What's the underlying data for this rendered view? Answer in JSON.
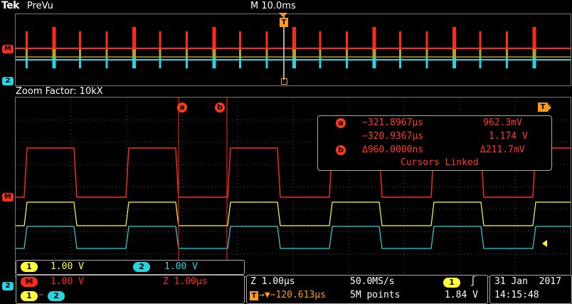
{
  "header": {
    "brand": "Tek",
    "mode": "PreVu",
    "timebase": "M 10.0ms"
  },
  "overview": {
    "trigger_marker": "T"
  },
  "zoom": {
    "label": "Zoom Factor: 10kX"
  },
  "markers": {
    "math_marker": "M",
    "ch2_marker": "2",
    "trigger_right": "T"
  },
  "cursors": {
    "a_label": "a",
    "b_label": "b",
    "readout": {
      "a_time": "−321.8967µs",
      "a_value": "962.3mV",
      "b_time": "−320.9367µs",
      "b_value": "1.174 V",
      "delta_time": "Δ960.0000ns",
      "delta_value": "Δ211.7mV",
      "linked": "Cursors Linked"
    }
  },
  "channels": {
    "ch1_badge": "1",
    "ch1_scale": "1.00 V",
    "ch2_badge": "2",
    "ch2_scale": "1.00 V"
  },
  "math": {
    "badge": "M",
    "scale": "1.00 V",
    "zoom_scale": "Z 1.00µs",
    "expr_left": "1",
    "expr_op": "−",
    "expr_right": "2"
  },
  "acquisition": {
    "zoom_time": "Z 1.00µs",
    "sample_rate": "50.0MS/s",
    "trigger_pos": "→▼−120.613µs",
    "record_length": "5M points",
    "trig_source": "1",
    "trig_slope": "∫",
    "trig_level": "1.84 V"
  },
  "datetime": {
    "date": "31 Jan  2017",
    "time": "14:15:48"
  },
  "colors": {
    "ch1": "#ffff3a",
    "ch2": "#29d4e0",
    "math": "#ff2a1a",
    "trigger": "#ff9a1a"
  }
}
